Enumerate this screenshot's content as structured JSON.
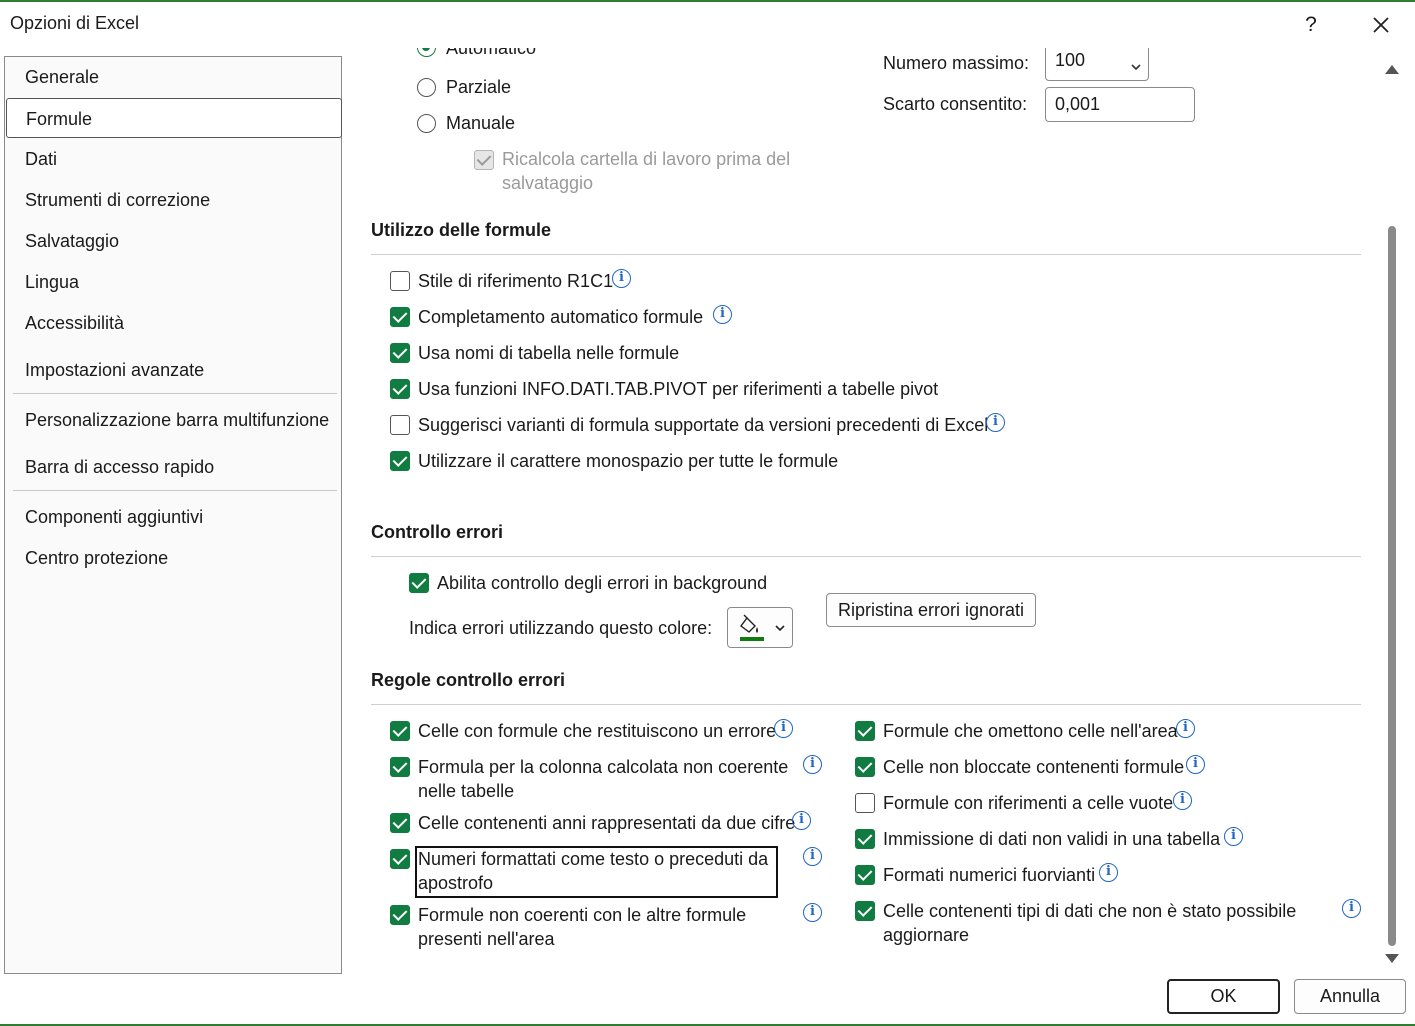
{
  "window": {
    "title": "Opzioni di Excel",
    "help_label": "?",
    "accent_color": "#107c41"
  },
  "sidebar": {
    "items": [
      {
        "label": "Generale"
      },
      {
        "label": "Formule"
      },
      {
        "label": "Dati"
      },
      {
        "label": "Strumenti di correzione"
      },
      {
        "label": "Salvataggio"
      },
      {
        "label": "Lingua"
      },
      {
        "label": "Accessibilità"
      },
      {
        "label": "Impostazioni avanzate"
      },
      {
        "label": "Personalizzazione barra multifunzione"
      },
      {
        "label": "Barra di accesso rapido"
      },
      {
        "label": "Componenti aggiuntivi"
      },
      {
        "label": "Centro protezione"
      }
    ],
    "selected": "Formule"
  },
  "calculation": {
    "automatic_label": "Automatico",
    "partial_label": "Parziale",
    "manual_label": "Manuale",
    "recalc_label": "Ricalcola cartella di lavoro prima del salvataggio",
    "recalc_checked": true,
    "recalc_disabled": true,
    "max_iterations_label": "Numero massimo:",
    "max_iterations_value": "100",
    "max_change_label": "Scarto consentito:",
    "max_change_value": "0,001"
  },
  "formulas": {
    "title": "Utilizzo delle formule",
    "options": [
      {
        "label": "Stile di riferimento R1C1",
        "checked": false,
        "info": true
      },
      {
        "label": "Completamento automatico formule",
        "checked": true,
        "info": true
      },
      {
        "label": "Usa nomi di tabella nelle formule",
        "checked": true,
        "info": false
      },
      {
        "label": "Usa funzioni INFO.DATI.TAB.PIVOT per riferimenti a tabelle pivot",
        "checked": true,
        "info": false
      },
      {
        "label": "Suggerisci varianti di formula supportate da versioni precedenti di Excel",
        "checked": false,
        "info": true
      },
      {
        "label": "Utilizzare il carattere monospazio per tutte le formule",
        "checked": true,
        "info": false
      }
    ]
  },
  "error_checking": {
    "title": "Controllo errori",
    "enable_label": "Abilita controllo degli errori in background",
    "enable_checked": true,
    "color_label": "Indica errori utilizzando questo colore:",
    "color_value": "#107c10",
    "reset_button_label": "Ripristina errori ignorati"
  },
  "rules": {
    "title": "Regole controllo errori",
    "left": [
      {
        "label": "Celle con formule che restituiscono un errore",
        "checked": true
      },
      {
        "label": "Formula per la colonna calcolata non coerente nelle tabelle",
        "checked": true
      },
      {
        "label": "Celle contenenti anni rappresentati da due cifre",
        "checked": true
      },
      {
        "label": "Numeri formattati come testo o preceduti da apostrofo",
        "checked": true,
        "focused": true
      },
      {
        "label": "Formule non coerenti con le altre formule presenti nell'area",
        "checked": true
      }
    ],
    "right": [
      {
        "label": "Formule che omettono celle nell'area",
        "checked": true
      },
      {
        "label": "Celle non bloccate contenenti formule",
        "checked": true
      },
      {
        "label": "Formule con riferimenti a celle vuote",
        "checked": false
      },
      {
        "label": "Immissione di dati non validi in una tabella",
        "checked": true
      },
      {
        "label": "Formati numerici fuorvianti",
        "checked": true
      },
      {
        "label": "Celle contenenti tipi di dati che non è stato possibile aggiornare",
        "checked": true
      }
    ]
  },
  "footer": {
    "ok_label": "OK",
    "cancel_label": "Annulla"
  }
}
